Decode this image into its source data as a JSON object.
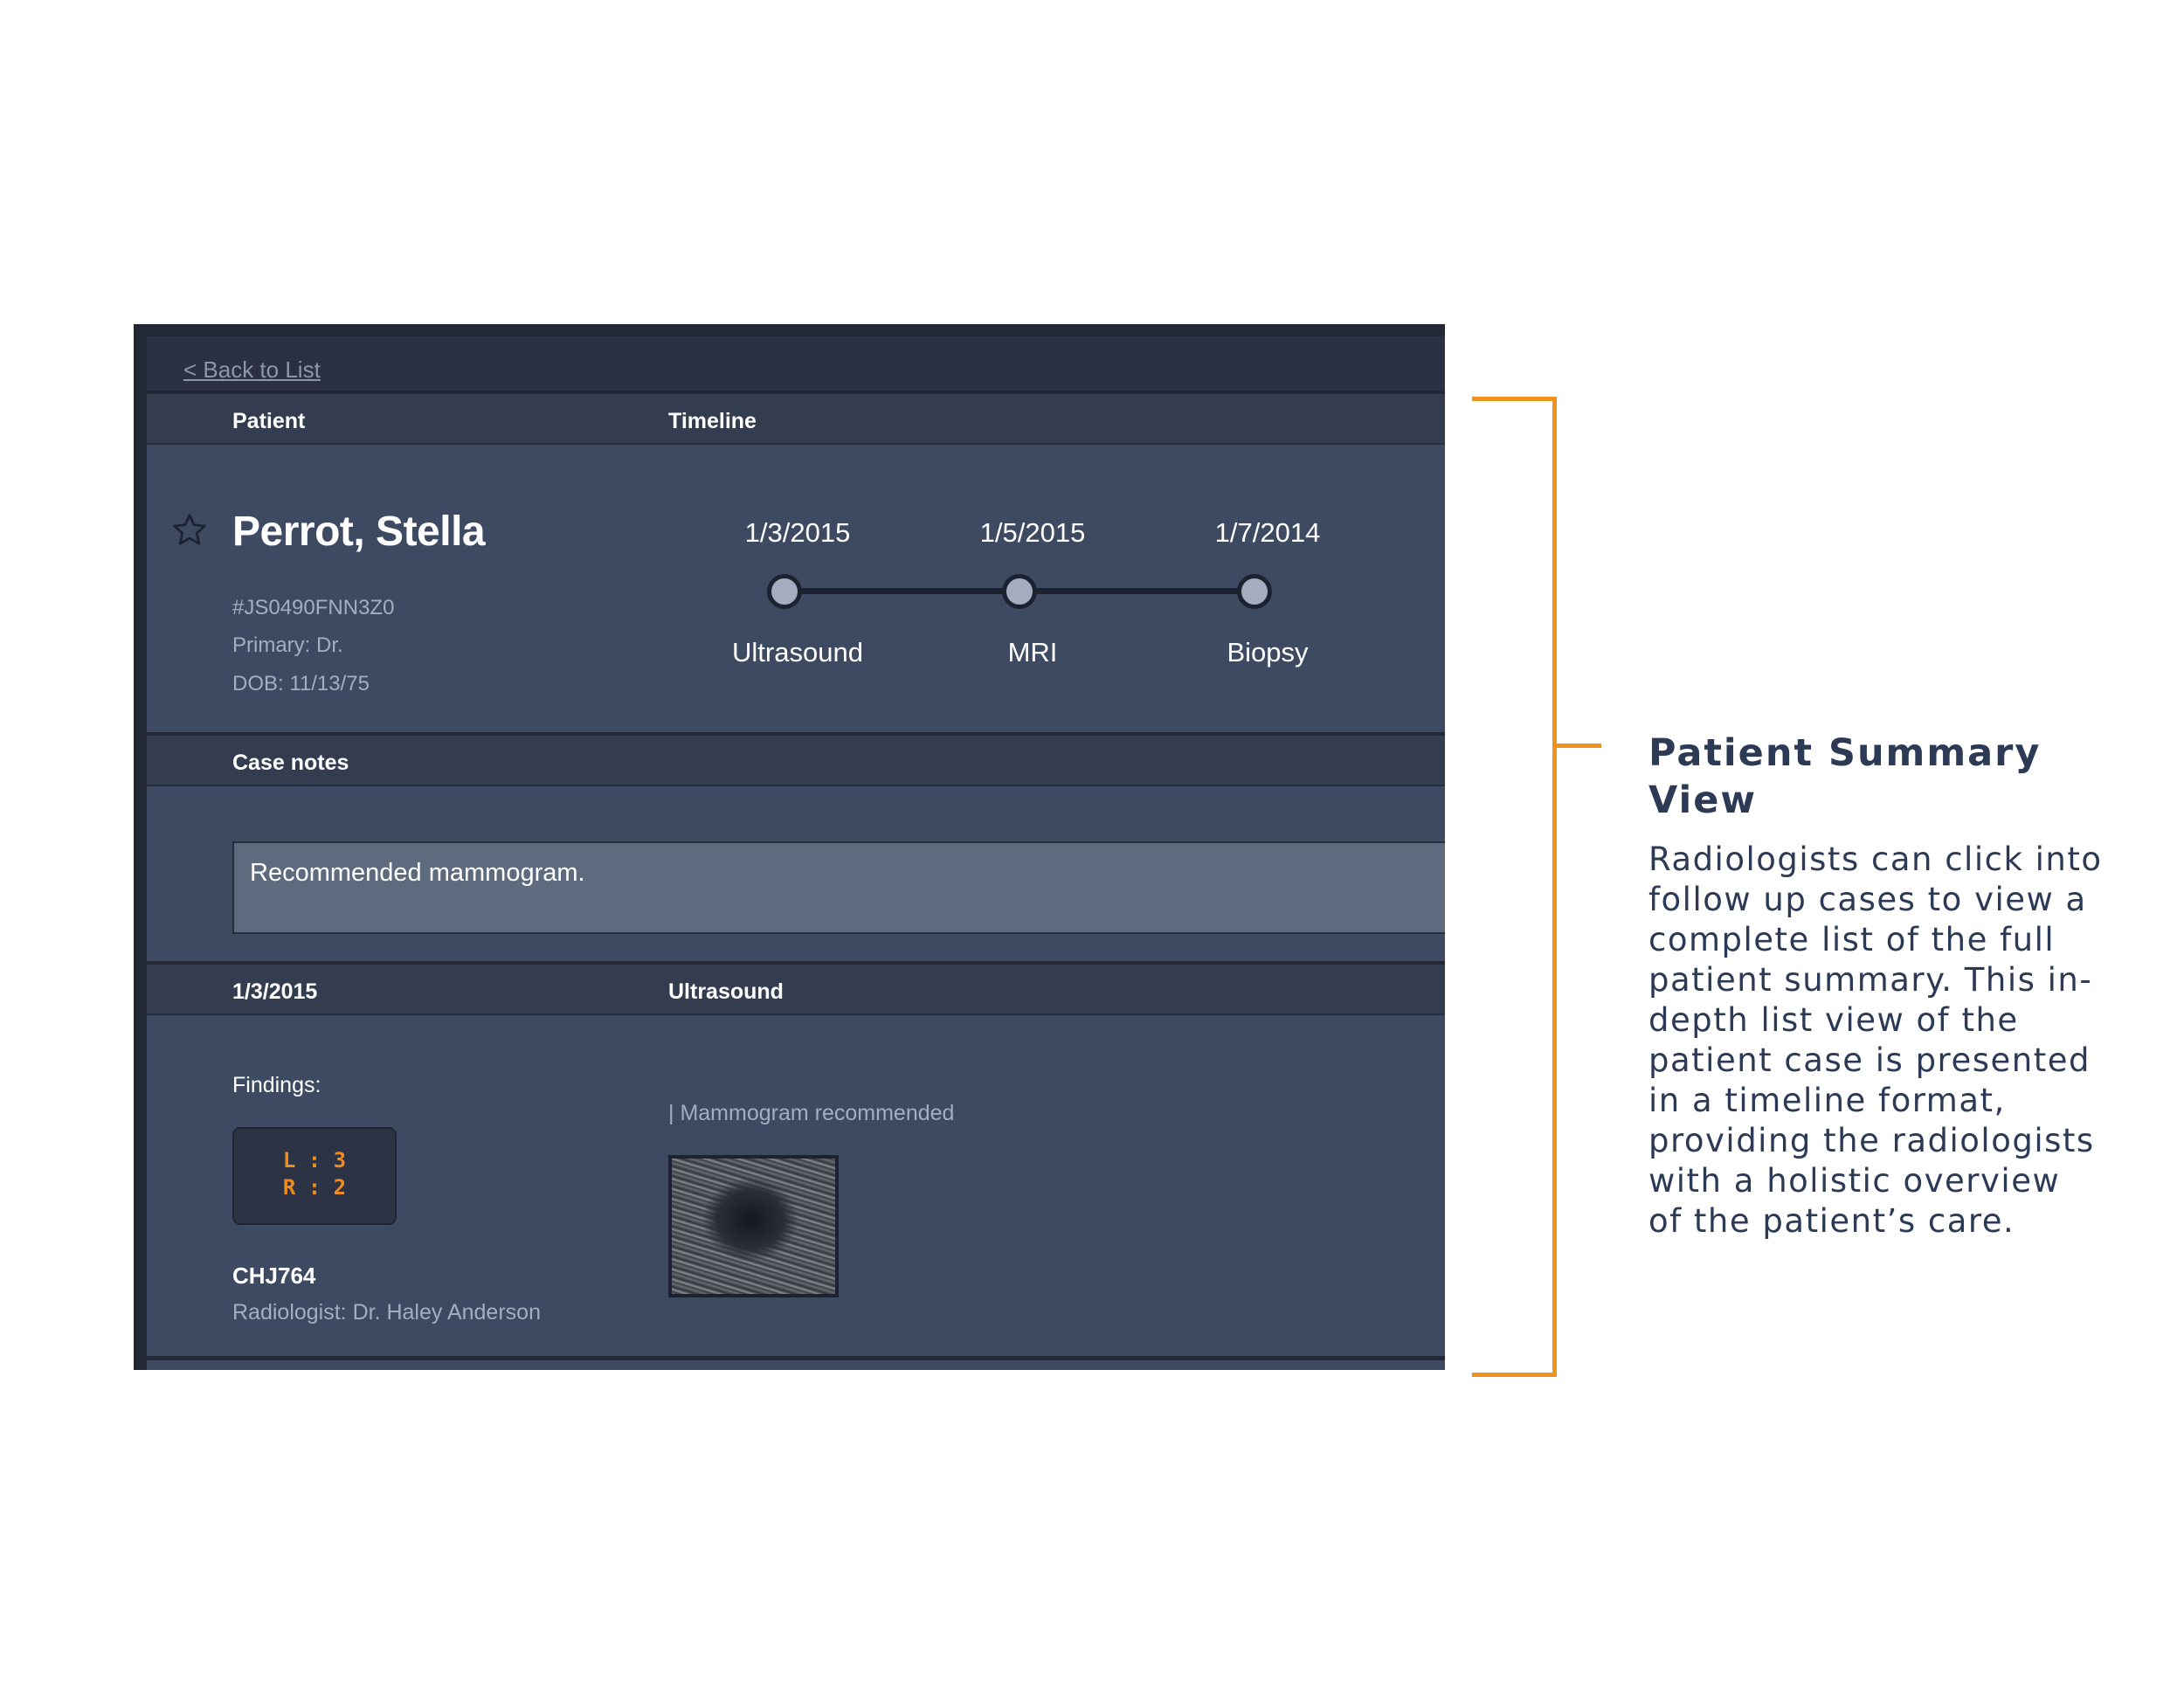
{
  "nav": {
    "back_label": "< Back to List"
  },
  "header": {
    "patient_col": "Patient",
    "timeline_col": "Timeline"
  },
  "patient": {
    "name": "Perrot, Stella",
    "id": "#JS0490FNN3Z0",
    "primary": "Primary: Dr.",
    "dob": "DOB: 11/13/75",
    "favorite_icon": "star-icon"
  },
  "timeline": {
    "events": [
      {
        "date": "1/3/2015",
        "label": "Ultrasound"
      },
      {
        "date": "1/5/2015",
        "label": "MRI"
      },
      {
        "date": "1/7/2014",
        "label": "Biopsy"
      }
    ]
  },
  "case_notes": {
    "title": "Case notes",
    "text": "Recommended mammogram."
  },
  "exam": {
    "date": "1/3/2015",
    "type": "Ultrasound",
    "findings_label": "Findings:",
    "score_left": "L : 3",
    "score_right": "R : 2",
    "code": "CHJ764",
    "radiologist": "Radiologist: Dr. Haley Anderson",
    "note": "| Mammogram recommended",
    "image": "ultrasound-scan-thumbnail"
  },
  "annotation": {
    "title": "Patient Summary View",
    "body": "Radiologists can click into follow up cases to view a complete list of the full patient summary. This in-depth list view of the patient case is presented in a timeline format, providing the radiologists with a holistic overview of the patient’s care.",
    "accent_color": "#f0931e"
  },
  "colors": {
    "background": "#3e4a62",
    "header": "#343d50",
    "score": "#f08c1c"
  }
}
